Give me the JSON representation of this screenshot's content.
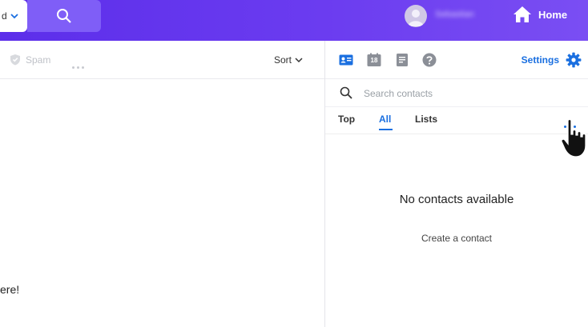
{
  "header": {
    "left_fragment": "d",
    "user_name": "Sebastian",
    "home_label": "Home",
    "icons": [
      "chevron-down-icon",
      "search-icon",
      "avatar",
      "home-icon"
    ],
    "colors": {
      "bar_start": "#5c2eea",
      "bar_end": "#7a4ef3",
      "search_btn": "#7f5ef7"
    }
  },
  "left_pane": {
    "spam_label": "Spam",
    "sort_label": "Sort",
    "message_fragment": "ere!",
    "icons": [
      "shield-icon",
      "more-horizontal-icon",
      "chevron-down-icon"
    ]
  },
  "right_pane": {
    "toolbar_icons": [
      "contacts-card-icon",
      "calendar-icon",
      "notepad-icon",
      "help-icon"
    ],
    "calendar_day": "18",
    "settings_label": "Settings",
    "search": {
      "placeholder": "Search contacts",
      "value": ""
    },
    "tabs": [
      {
        "label": "Top",
        "active": false
      },
      {
        "label": "All",
        "active": true
      },
      {
        "label": "Lists",
        "active": false
      }
    ],
    "empty_title": "No contacts available",
    "create_label": "Create a contact",
    "accent": "#1a6fe0"
  }
}
